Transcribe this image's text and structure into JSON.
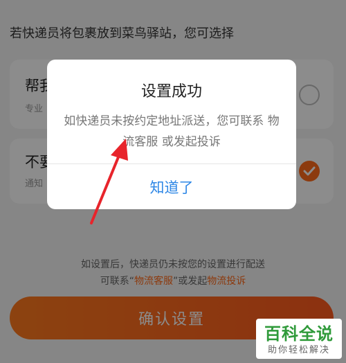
{
  "page": {
    "intro": "若快递员将包裹放到菜鸟驿站，您可选择",
    "options": [
      {
        "title": "帮我",
        "sub": "专业",
        "selected": false
      },
      {
        "title": "不要",
        "sub": "通知",
        "selected": true
      }
    ],
    "note": {
      "line1": "如设置后，快递员仍未按您的设置进行配送",
      "line2_prefix": "可联系“",
      "line2_link1": "物流客服",
      "line2_mid": "”或发起",
      "line2_link2": "物流投诉"
    },
    "confirm_label": "确认设置"
  },
  "dialog": {
    "title": "设置成功",
    "body": "如快递员未按约定地址派送，您可联系 物流客服 或发起投诉",
    "button": "知道了"
  },
  "watermark": {
    "main": "百科全说",
    "sub": "助你轻松解决"
  },
  "colors": {
    "accent": "#ff6a1a",
    "dialog_button": "#2e87e6",
    "annotation_arrow": "#e8242b",
    "watermark": "#2f9a3a"
  }
}
